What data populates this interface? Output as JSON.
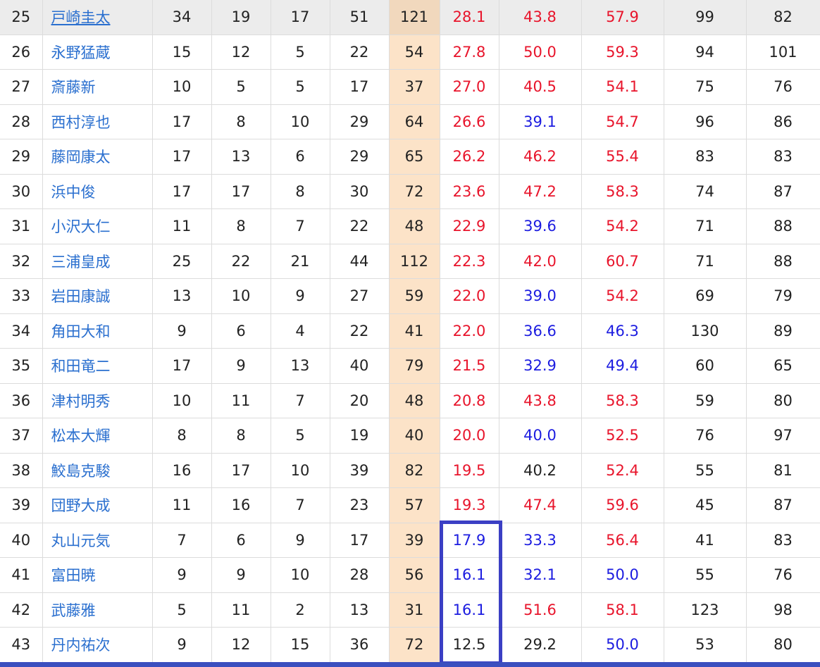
{
  "colors": {
    "link": "#2a6fcf",
    "high": "#e8142b",
    "low": "#1c1ce0",
    "neutral": "#222222",
    "highlight_column": "#fce3c8",
    "selection_border": "#3b3fc4"
  },
  "rows": [
    {
      "rank": "25",
      "name": "戸崎圭太",
      "c1": "34",
      "c2": "19",
      "c3": "17",
      "c4": "51",
      "total": "121",
      "r1": "28.1",
      "r2": "43.8",
      "r3": "57.9",
      "n1": "99",
      "n2": "82",
      "r1_color": "red",
      "r2_color": "red",
      "r3_color": "red"
    },
    {
      "rank": "26",
      "name": "永野猛蔵",
      "c1": "15",
      "c2": "12",
      "c3": "5",
      "c4": "22",
      "total": "54",
      "r1": "27.8",
      "r2": "50.0",
      "r3": "59.3",
      "n1": "94",
      "n2": "101",
      "r1_color": "red",
      "r2_color": "red",
      "r3_color": "red"
    },
    {
      "rank": "27",
      "name": "斎藤新",
      "c1": "10",
      "c2": "5",
      "c3": "5",
      "c4": "17",
      "total": "37",
      "r1": "27.0",
      "r2": "40.5",
      "r3": "54.1",
      "n1": "75",
      "n2": "76",
      "r1_color": "red",
      "r2_color": "red",
      "r3_color": "red"
    },
    {
      "rank": "28",
      "name": "西村淳也",
      "c1": "17",
      "c2": "8",
      "c3": "10",
      "c4": "29",
      "total": "64",
      "r1": "26.6",
      "r2": "39.1",
      "r3": "54.7",
      "n1": "96",
      "n2": "86",
      "r1_color": "red",
      "r2_color": "blue",
      "r3_color": "red"
    },
    {
      "rank": "29",
      "name": "藤岡康太",
      "c1": "17",
      "c2": "13",
      "c3": "6",
      "c4": "29",
      "total": "65",
      "r1": "26.2",
      "r2": "46.2",
      "r3": "55.4",
      "n1": "83",
      "n2": "83",
      "r1_color": "red",
      "r2_color": "red",
      "r3_color": "red"
    },
    {
      "rank": "30",
      "name": "浜中俊",
      "c1": "17",
      "c2": "17",
      "c3": "8",
      "c4": "30",
      "total": "72",
      "r1": "23.6",
      "r2": "47.2",
      "r3": "58.3",
      "n1": "74",
      "n2": "87",
      "r1_color": "red",
      "r2_color": "red",
      "r3_color": "red"
    },
    {
      "rank": "31",
      "name": "小沢大仁",
      "c1": "11",
      "c2": "8",
      "c3": "7",
      "c4": "22",
      "total": "48",
      "r1": "22.9",
      "r2": "39.6",
      "r3": "54.2",
      "n1": "71",
      "n2": "88",
      "r1_color": "red",
      "r2_color": "blue",
      "r3_color": "red"
    },
    {
      "rank": "32",
      "name": "三浦皇成",
      "c1": "25",
      "c2": "22",
      "c3": "21",
      "c4": "44",
      "total": "112",
      "r1": "22.3",
      "r2": "42.0",
      "r3": "60.7",
      "n1": "71",
      "n2": "88",
      "r1_color": "red",
      "r2_color": "red",
      "r3_color": "red"
    },
    {
      "rank": "33",
      "name": "岩田康誠",
      "c1": "13",
      "c2": "10",
      "c3": "9",
      "c4": "27",
      "total": "59",
      "r1": "22.0",
      "r2": "39.0",
      "r3": "54.2",
      "n1": "69",
      "n2": "79",
      "r1_color": "red",
      "r2_color": "blue",
      "r3_color": "red"
    },
    {
      "rank": "34",
      "name": "角田大和",
      "c1": "9",
      "c2": "6",
      "c3": "4",
      "c4": "22",
      "total": "41",
      "r1": "22.0",
      "r2": "36.6",
      "r3": "46.3",
      "n1": "130",
      "n2": "89",
      "r1_color": "red",
      "r2_color": "blue",
      "r3_color": "blue"
    },
    {
      "rank": "35",
      "name": "和田竜二",
      "c1": "17",
      "c2": "9",
      "c3": "13",
      "c4": "40",
      "total": "79",
      "r1": "21.5",
      "r2": "32.9",
      "r3": "49.4",
      "n1": "60",
      "n2": "65",
      "r1_color": "red",
      "r2_color": "blue",
      "r3_color": "blue"
    },
    {
      "rank": "36",
      "name": "津村明秀",
      "c1": "10",
      "c2": "11",
      "c3": "7",
      "c4": "20",
      "total": "48",
      "r1": "20.8",
      "r2": "43.8",
      "r3": "58.3",
      "n1": "59",
      "n2": "80",
      "r1_color": "red",
      "r2_color": "red",
      "r3_color": "red"
    },
    {
      "rank": "37",
      "name": "松本大輝",
      "c1": "8",
      "c2": "8",
      "c3": "5",
      "c4": "19",
      "total": "40",
      "r1": "20.0",
      "r2": "40.0",
      "r3": "52.5",
      "n1": "76",
      "n2": "97",
      "r1_color": "red",
      "r2_color": "blue",
      "r3_color": "red"
    },
    {
      "rank": "38",
      "name": "鮫島克駿",
      "c1": "16",
      "c2": "17",
      "c3": "10",
      "c4": "39",
      "total": "82",
      "r1": "19.5",
      "r2": "40.2",
      "r3": "52.4",
      "n1": "55",
      "n2": "81",
      "r1_color": "red",
      "r2_color": "black",
      "r3_color": "red"
    },
    {
      "rank": "39",
      "name": "団野大成",
      "c1": "11",
      "c2": "16",
      "c3": "7",
      "c4": "23",
      "total": "57",
      "r1": "19.3",
      "r2": "47.4",
      "r3": "59.6",
      "n1": "45",
      "n2": "87",
      "r1_color": "red",
      "r2_color": "red",
      "r3_color": "red"
    },
    {
      "rank": "40",
      "name": "丸山元気",
      "c1": "7",
      "c2": "6",
      "c3": "9",
      "c4": "17",
      "total": "39",
      "r1": "17.9",
      "r2": "33.3",
      "r3": "56.4",
      "n1": "41",
      "n2": "83",
      "r1_color": "blue",
      "r2_color": "blue",
      "r3_color": "red"
    },
    {
      "rank": "41",
      "name": "富田暁",
      "c1": "9",
      "c2": "9",
      "c3": "10",
      "c4": "28",
      "total": "56",
      "r1": "16.1",
      "r2": "32.1",
      "r3": "50.0",
      "n1": "55",
      "n2": "76",
      "r1_color": "blue",
      "r2_color": "blue",
      "r3_color": "blue"
    },
    {
      "rank": "42",
      "name": "武藤雅",
      "c1": "5",
      "c2": "11",
      "c3": "2",
      "c4": "13",
      "total": "31",
      "r1": "16.1",
      "r2": "51.6",
      "r3": "58.1",
      "n1": "123",
      "n2": "98",
      "r1_color": "blue",
      "r2_color": "red",
      "r3_color": "red"
    },
    {
      "rank": "43",
      "name": "丹内祐次",
      "c1": "9",
      "c2": "12",
      "c3": "15",
      "c4": "36",
      "total": "72",
      "r1": "12.5",
      "r2": "29.2",
      "r3": "50.0",
      "n1": "53",
      "n2": "80",
      "r1_color": "black",
      "r2_color": "black",
      "r3_color": "blue"
    }
  ]
}
